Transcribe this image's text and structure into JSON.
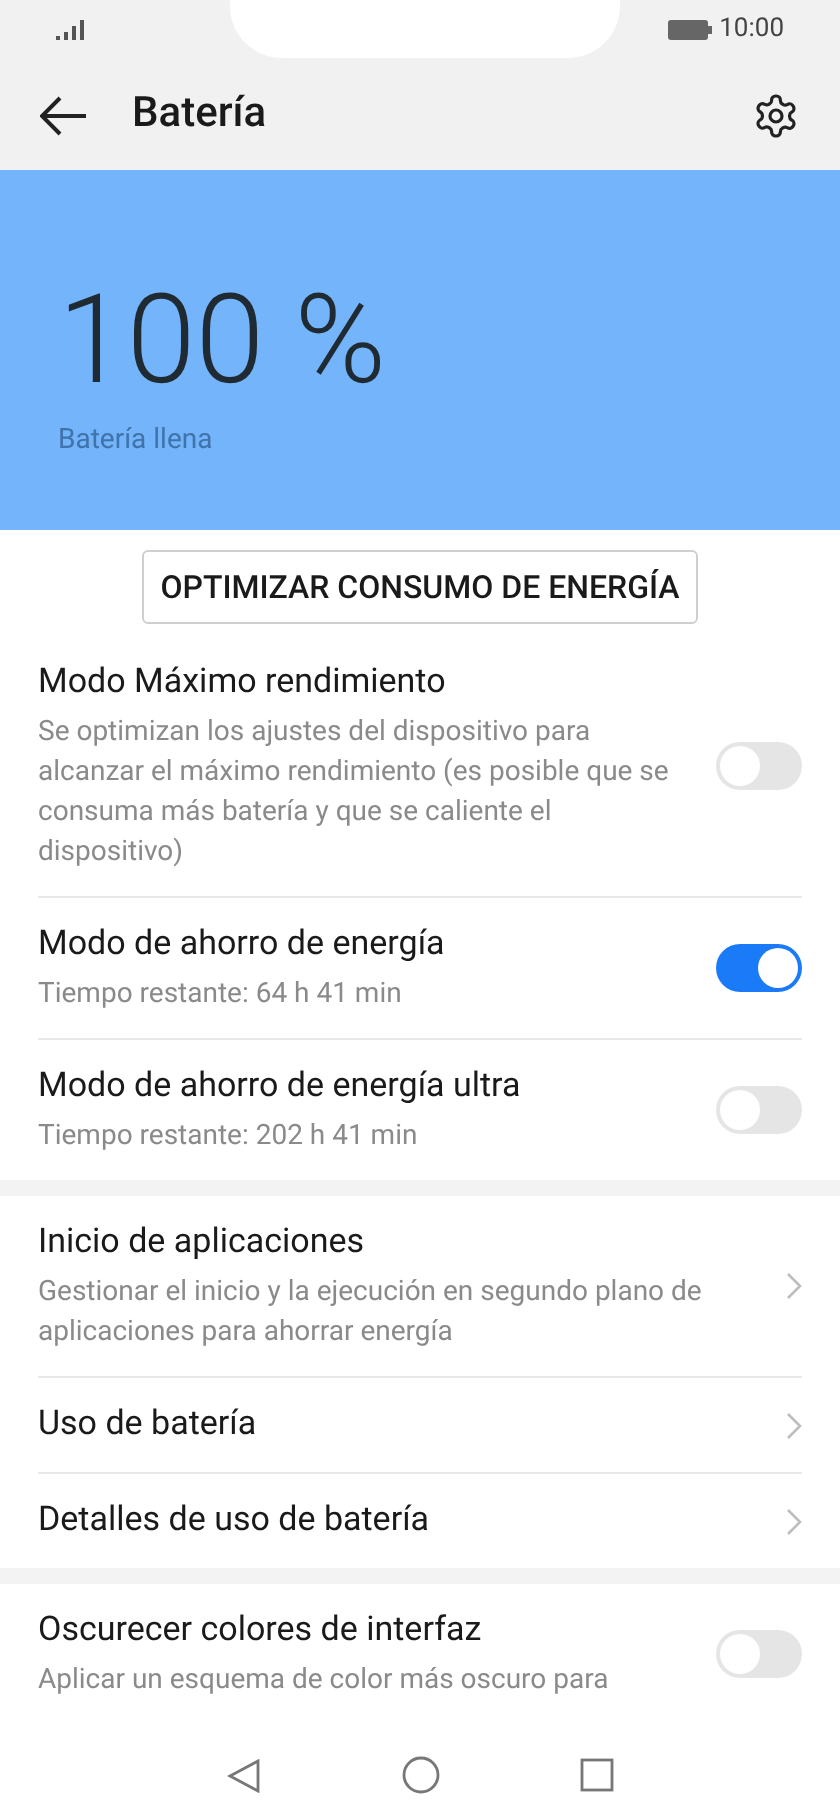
{
  "status_bar": {
    "time": "10:00"
  },
  "header": {
    "title": "Batería"
  },
  "battery": {
    "percent": "100 %",
    "status": "Batería llena"
  },
  "optimize_button": "OPTIMIZAR CONSUMO DE ENERGÍA",
  "groups": [
    {
      "items": [
        {
          "kind": "toggle",
          "title": "Modo Máximo rendimiento",
          "subtitle": "Se optimizan los ajustes del dispositivo para alcanzar el máximo rendimiento (es posible que se consuma más batería y que se caliente el dispositivo)",
          "on": false
        },
        {
          "kind": "toggle",
          "title": "Modo de ahorro de energía",
          "subtitle": "Tiempo restante: 64 h 41 min",
          "on": true
        },
        {
          "kind": "toggle",
          "title": "Modo de ahorro de energía ultra",
          "subtitle": "Tiempo restante: 202 h 41 min",
          "on": false
        }
      ]
    },
    {
      "items": [
        {
          "kind": "link",
          "title": "Inicio de aplicaciones",
          "subtitle": "Gestionar el inicio y la ejecución en segundo plano de aplicaciones para ahorrar energía"
        },
        {
          "kind": "link",
          "title": "Uso de batería"
        },
        {
          "kind": "link",
          "title": "Detalles de uso de batería"
        }
      ]
    },
    {
      "items": [
        {
          "kind": "toggle",
          "title": "Oscurecer colores de interfaz",
          "subtitle": "Aplicar un esquema de color más oscuro para",
          "on": false
        }
      ]
    }
  ]
}
